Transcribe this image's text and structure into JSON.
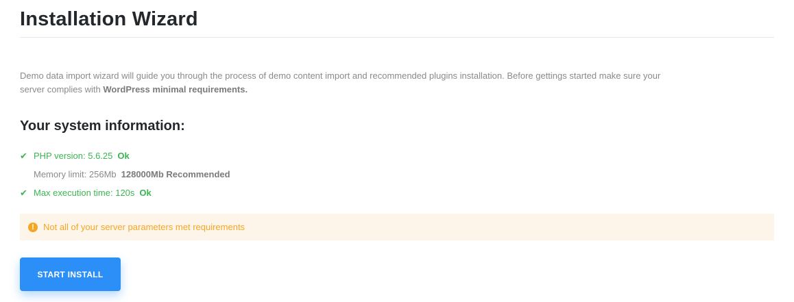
{
  "header": {
    "title": "Installation Wizard"
  },
  "intro": {
    "text_before": "Demo data import wizard will guide you through the process of demo content import and recommended plugins installation. Before gettings started make sure your server complies with ",
    "strong_text": "WordPress minimal requirements."
  },
  "system": {
    "heading": "Your system information:",
    "checks": [
      {
        "label": "PHP version: 5.6.25",
        "status": "Ok",
        "state": "ok",
        "icon": "check-icon"
      },
      {
        "label": "Memory limit: 256Mb",
        "status": "128000Mb Recommended",
        "state": "warning",
        "icon": ""
      },
      {
        "label": "Max execution time: 120s",
        "status": "Ok",
        "state": "ok",
        "icon": "check-icon"
      }
    ]
  },
  "alert": {
    "icon": "exclamation-circle-icon",
    "text": "Not all of your server parameters met requirements"
  },
  "actions": {
    "start_label": "START INSTALL"
  },
  "colors": {
    "ok": "#3bb552",
    "warning": "#f5a623",
    "alert_bg": "#fef5ea",
    "primary": "#2b8ff7"
  }
}
